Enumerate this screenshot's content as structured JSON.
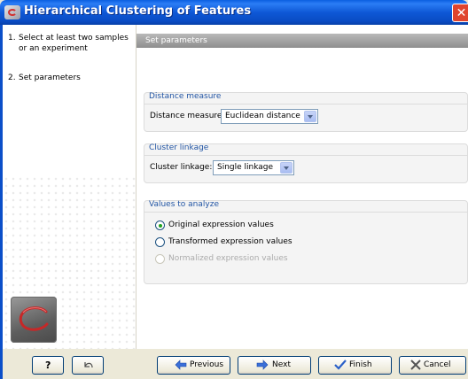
{
  "window": {
    "title": "Hierarchical Clustering of Features",
    "close_glyph": "✕"
  },
  "sidebar": {
    "steps": [
      {
        "num": "1.",
        "label": "Select at least two samples or an experiment"
      },
      {
        "num": "2.",
        "label": "Set parameters"
      }
    ]
  },
  "main": {
    "header": "Set parameters",
    "distance": {
      "group_title": "Distance measure",
      "label": "Distance measure:",
      "value": "Euclidean distance"
    },
    "linkage": {
      "group_title": "Cluster linkage",
      "label": "Cluster linkage:",
      "value": "Single linkage"
    },
    "values": {
      "group_title": "Values to analyze",
      "options": [
        {
          "label": "Original expression values",
          "checked": true,
          "enabled": true
        },
        {
          "label": "Transformed expression values",
          "checked": false,
          "enabled": true
        },
        {
          "label": "Normalized expression values",
          "checked": false,
          "enabled": false
        }
      ]
    }
  },
  "buttons": {
    "help": "?",
    "reset_icon": "undo-icon",
    "previous": "Previous",
    "next": "Next",
    "finish": "Finish",
    "cancel": "Cancel"
  },
  "colors": {
    "title_bar": "#0a5fe0",
    "group_title": "#2255a4",
    "radio_checked": "#21a121"
  }
}
